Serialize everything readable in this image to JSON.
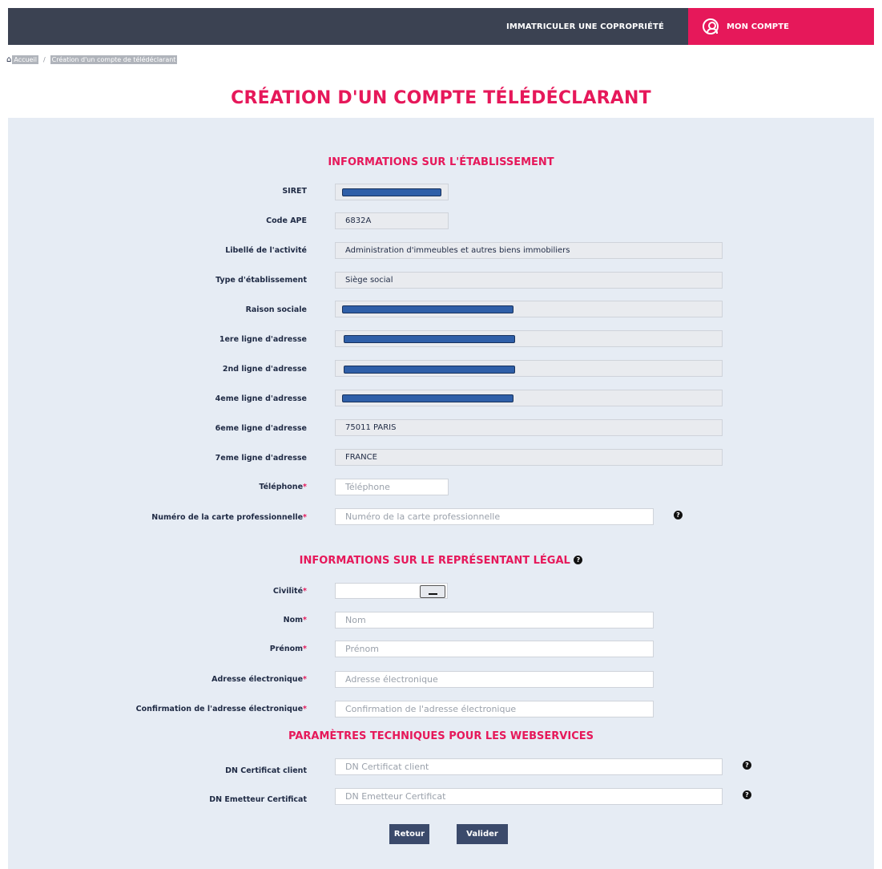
{
  "nav": {
    "immatriculer": "IMMATRICULER UNE COPROPRIÉTÉ",
    "account": "MON COMPTE"
  },
  "breadcrumb": {
    "home": "Accueil",
    "separator": "/",
    "current": "Création d'un compte de télédéclarant"
  },
  "page_title": "CRÉATION D'UN COMPTE TÉLÉDÉCLARANT",
  "etablissement": {
    "title": "INFORMATIONS SUR L'ÉTABLISSEMENT",
    "siret_label": "SIRET",
    "ape_label": "Code APE",
    "ape_value": "6832A",
    "activite_label": "Libellé de l'activité",
    "activite_value": "Administration d'immeubles et autres biens immobiliers",
    "type_label": "Type d'établissement",
    "type_value": "Siège social",
    "raison_label": "Raison sociale",
    "adr1_label": "1ere ligne d'adresse",
    "adr2_label": "2nd ligne d'adresse",
    "adr4_label": "4eme ligne d'adresse",
    "adr6_label": "6eme ligne d'adresse",
    "adr6_value": "75011 PARIS",
    "adr7_label": "7eme ligne d'adresse",
    "adr7_value": "FRANCE",
    "tel_label": "Téléphone",
    "tel_placeholder": "Téléphone",
    "carte_label": "Numéro de la carte professionnelle",
    "carte_placeholder": "Numéro de la carte professionnelle"
  },
  "representant": {
    "title": "INFORMATIONS SUR LE REPRÉSENTANT LÉGAL",
    "civilite_label": "Civilité",
    "nom_label": "Nom",
    "nom_placeholder": "Nom",
    "prenom_label": "Prénom",
    "prenom_placeholder": "Prénom",
    "email_label": "Adresse électronique",
    "email_placeholder": "Adresse électronique",
    "email_confirm_label": "Confirmation de l'adresse électronique",
    "email_confirm_placeholder": "Confirmation de l'adresse électronique"
  },
  "webservices": {
    "title": "PARAMÈTRES TECHNIQUES POUR LES WEBSERVICES",
    "dn_client_label": "DN Certificat client",
    "dn_client_placeholder": "DN Certificat client",
    "dn_emetteur_label": "DN Emetteur Certificat",
    "dn_emetteur_placeholder": "DN Emetteur Certificat"
  },
  "required_mark": "*",
  "help_glyph": "?",
  "buttons": {
    "retour": "Retour",
    "valider": "Valider"
  },
  "colors": {
    "accent": "#e6185a",
    "topbar": "#3b4252",
    "panel": "#e6ecf4",
    "button": "#3b4a6b"
  }
}
